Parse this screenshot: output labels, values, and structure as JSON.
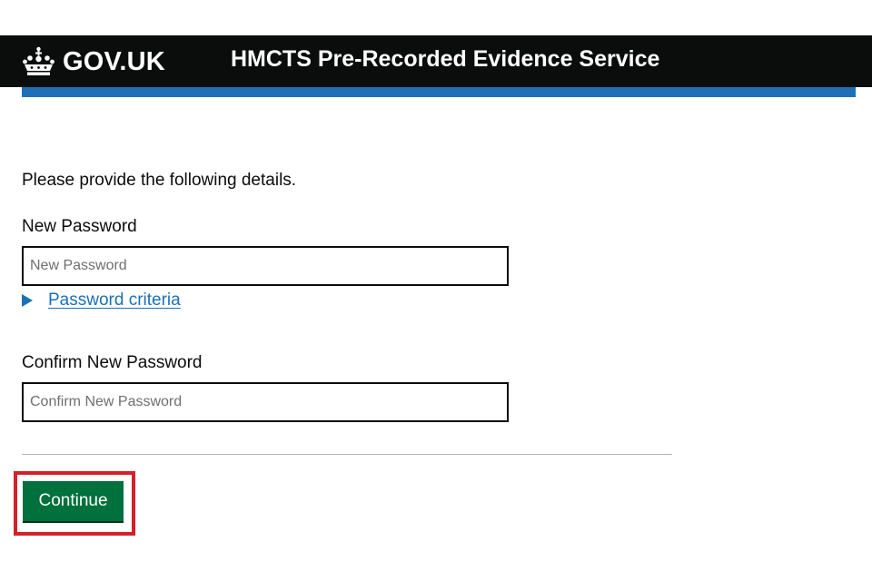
{
  "header": {
    "logo_text": "GOV.UK",
    "logo_icon": "crown-icon",
    "service_name": "HMCTS Pre-Recorded Evidence Service"
  },
  "form": {
    "intro": "Please provide the following details.",
    "new_password": {
      "label": "New Password",
      "placeholder": "New Password",
      "value": ""
    },
    "password_criteria": {
      "label": "Password criteria",
      "icon": "triangle-right-icon"
    },
    "confirm_password": {
      "label": "Confirm New Password",
      "placeholder": "Confirm New Password",
      "value": ""
    },
    "continue_label": "Continue"
  },
  "colors": {
    "header_bg": "#0b0c0c",
    "stripe": "#1d70b8",
    "link": "#1d70b8",
    "button": "#00703c",
    "highlight": "#d4202a"
  }
}
